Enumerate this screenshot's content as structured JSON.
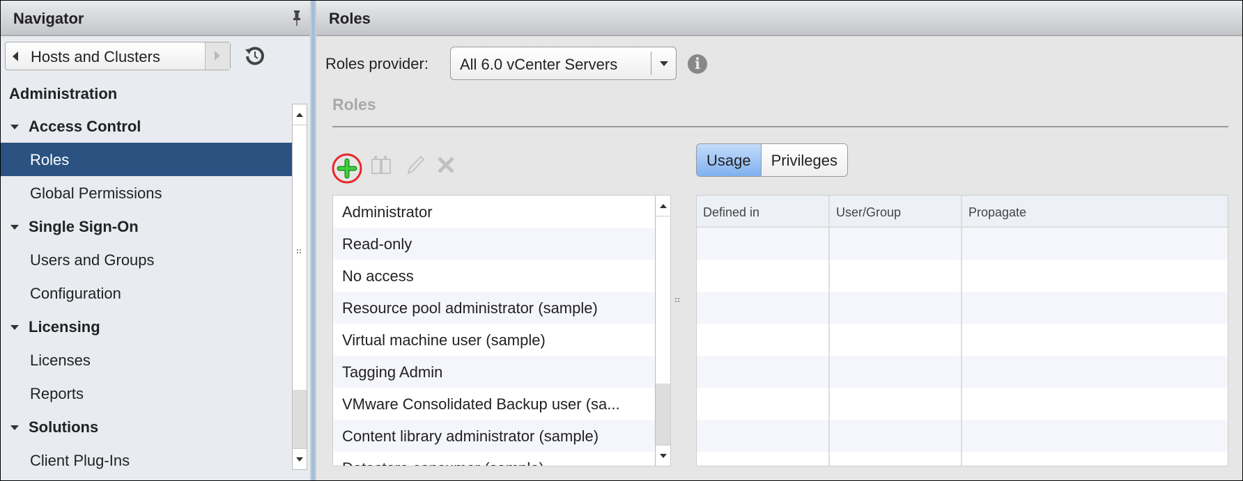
{
  "navigator": {
    "title": "Navigator",
    "history_label": "Hosts and Clusters",
    "section": "Administration",
    "items": [
      {
        "label": "Access Control",
        "type": "category"
      },
      {
        "label": "Roles",
        "type": "item",
        "selected": true
      },
      {
        "label": "Global Permissions",
        "type": "item"
      },
      {
        "label": "Single Sign-On",
        "type": "category"
      },
      {
        "label": "Users and Groups",
        "type": "item"
      },
      {
        "label": "Configuration",
        "type": "item"
      },
      {
        "label": "Licensing",
        "type": "category"
      },
      {
        "label": "Licenses",
        "type": "item"
      },
      {
        "label": "Reports",
        "type": "item"
      },
      {
        "label": "Solutions",
        "type": "category"
      },
      {
        "label": "Client Plug-Ins",
        "type": "item"
      }
    ]
  },
  "main": {
    "title": "Roles",
    "provider_label": "Roles provider:",
    "provider_value": "All 6.0 vCenter Servers",
    "section_title": "Roles",
    "tabs": [
      {
        "label": "Usage",
        "active": true
      },
      {
        "label": "Privileges",
        "active": false
      }
    ],
    "roles": [
      "Administrator",
      "Read-only",
      "No access",
      "Resource pool administrator (sample)",
      "Virtual machine user (sample)",
      "Tagging Admin",
      "VMware Consolidated Backup user (sa...",
      "Content library administrator (sample)",
      "Datastore consumer (sample)"
    ],
    "columns": [
      "Defined in",
      "User/Group",
      "Propagate"
    ]
  },
  "colors": {
    "selected": "#2b5281",
    "add": "#2db52d",
    "highlight_circle": "#e8262a",
    "active_tab": "#7fb1f0"
  }
}
